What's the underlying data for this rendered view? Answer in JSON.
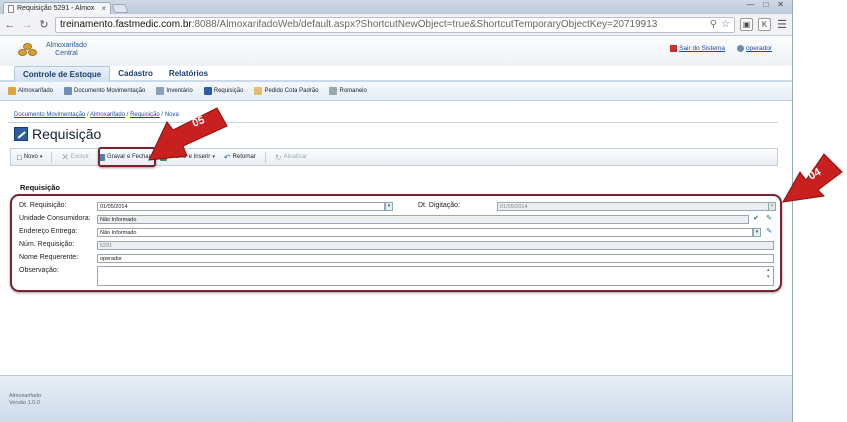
{
  "browser": {
    "tab_title": "Requisição 5291 - Almox",
    "tab_close": "×",
    "url_host": "treinamento.fastmedic.com.br",
    "url_rest": ":8088/AlmoxarifadoWeb/default.aspx?ShortcutNewObject=true&ShortcutTemporaryObjectKey=20719913"
  },
  "app": {
    "name_line1": "Almoxarifado",
    "name_line2": "Central",
    "logout_label": "Sair do Sistema",
    "user_label": "operador"
  },
  "menu": {
    "items": [
      "Controle de Estoque",
      "Cadastro",
      "Relatórios"
    ]
  },
  "submenu": {
    "items": [
      "Almoxarifado",
      "Documento Movimentação",
      "Inventário",
      "Requisição",
      "Pedido Cota Padrão",
      "Romaneio"
    ]
  },
  "breadcrumb": [
    "Documento Movimentação",
    "Almoxarifado",
    "Requisição",
    "Nova"
  ],
  "page_title": "Requisição",
  "toolbar": {
    "new": "Novo",
    "delete": "Excluir",
    "save_close": "Gravar e Fechar",
    "save_insert": "Gravar e Inserir",
    "back": "Retornar",
    "refresh": "Atualizar"
  },
  "form": {
    "section_title": "Requisição",
    "dt_requisicao": {
      "label": "Dt. Requisição:",
      "value": "01/05/2014"
    },
    "dt_digitacao": {
      "label": "Dt. Digitação:",
      "value": "01/05/2014"
    },
    "unidade": {
      "label": "Unidade Consumidora:",
      "value": "Não Informado"
    },
    "endereco": {
      "label": "Endereço Entrega:",
      "value": "Não Informado"
    },
    "num": {
      "label": "Núm. Requisição:",
      "value": "5291"
    },
    "nome": {
      "label": "Nome Requerente:",
      "value": "operador"
    },
    "obs": {
      "label": "Observação:",
      "value": ""
    }
  },
  "footer": {
    "app": "Almoxarifado",
    "version": "Versão 1.0.0"
  },
  "callouts": {
    "a": "05",
    "b": "04"
  },
  "colors": {
    "highlight": "#7a2330",
    "arrow": "#c8201e",
    "accent": "#2d5fa0"
  }
}
